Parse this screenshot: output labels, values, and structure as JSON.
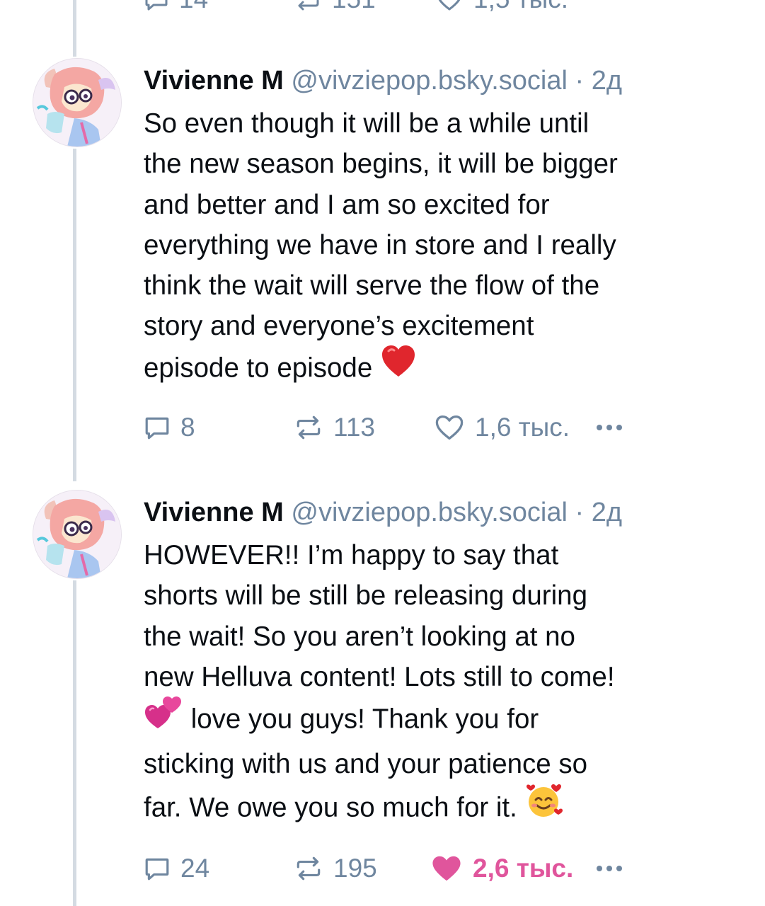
{
  "colors": {
    "text": "#0b0f14",
    "muted": "#6f869f",
    "thread_line": "#d4dbe2",
    "like_active": "#e0559c"
  },
  "previous_post": {
    "replies": "14",
    "reposts": "151",
    "likes": "1,5 тыс."
  },
  "posts": [
    {
      "author_name": "Vivienne M",
      "handle": "@vivziepop.bsky.social",
      "separator": "·",
      "time": "2д",
      "lines": [
        "So even though it will be a while until",
        "the new season begins, it will be bigger",
        "and better and I am so excited for",
        "everything we have in store and I really",
        "think the wait will serve the flow of the",
        "story and everyone’s excitement",
        "episode to episode"
      ],
      "replies": "8",
      "reposts": "113",
      "likes": "1,6 тыс.",
      "liked": false
    },
    {
      "author_name": "Vivienne M",
      "handle": "@vivziepop.bsky.social",
      "separator": "·",
      "time": "2д",
      "lines": [
        "HOWEVER!! I’m happy to say that",
        "shorts will be still be releasing during",
        "the wait! So you aren’t looking at no",
        "new Helluva content! Lots still to come!",
        "love you guys! Thank you for",
        "sticking with us and your patience so",
        "far. We owe you so much for it."
      ],
      "replies": "24",
      "reposts": "195",
      "likes": "2,6 тыс.",
      "liked": true
    }
  ],
  "icons": {
    "reply": "reply-bubble-icon",
    "repost": "repost-arrows-icon",
    "like": "heart-icon",
    "more": "more-dots-icon",
    "emoji_heart": "red-heart-emoji",
    "emoji_two_hearts": "two-hearts-emoji",
    "emoji_smiling_hearts": "smiling-face-with-hearts-emoji"
  }
}
